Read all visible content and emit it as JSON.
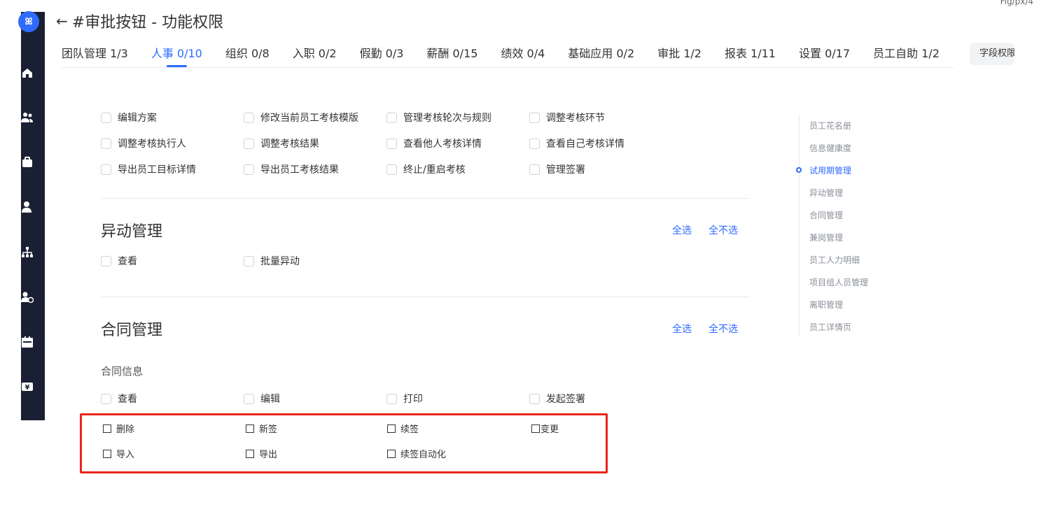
{
  "window": {
    "title": "#审批按钮 - 功能权限",
    "top_right_text": "Fig/px/4"
  },
  "sidebar": {
    "logo_text": "ꕤ",
    "icons": [
      "home-icon",
      "team-icon",
      "briefcase-icon",
      "person-icon",
      "org-chart-icon",
      "person-add-icon",
      "calendar-icon",
      "yen-icon"
    ]
  },
  "tabs": [
    {
      "label": "团队管理 1/3"
    },
    {
      "label": "人事 0/10"
    },
    {
      "label": "组织 0/8"
    },
    {
      "label": "入职 0/2"
    },
    {
      "label": "假勤 0/3"
    },
    {
      "label": "薪酬 0/15"
    },
    {
      "label": "绩效 0/4"
    },
    {
      "label": "基础应用 0/2"
    },
    {
      "label": "审批 1/2"
    },
    {
      "label": "报表 1/11"
    },
    {
      "label": "设置 0/17"
    },
    {
      "label": "员工自助 1/2"
    }
  ],
  "active_tab": 1,
  "field_perm_button": "字段权限",
  "probation": {
    "items": [
      "编辑方案",
      "修改当前员工考核模版",
      "管理考核轮次与规则",
      "调整考核环节",
      "调整考核执行人",
      "调整考核结果",
      "查看他人考核详情",
      "查看自己考核详情",
      "导出员工目标详情",
      "导出员工考核结果",
      "终止/重启考核",
      "管理签署"
    ]
  },
  "change_mgmt": {
    "title": "异动管理",
    "select_all": "全选",
    "deselect_all": "全不选",
    "items": [
      "查看",
      "批量异动"
    ]
  },
  "contract_mgmt": {
    "title": "合同管理",
    "select_all": "全选",
    "deselect_all": "全不选",
    "subsection": "合同信息",
    "items": [
      "查看",
      "编辑",
      "打印",
      "发起签署"
    ],
    "new_items": [
      "删除",
      "新签",
      "续签",
      "变更",
      "导入",
      "导出",
      "续签自动化"
    ]
  },
  "anchor_nav": {
    "items": [
      "员工花名册",
      "信息健康度",
      "试用期管理",
      "异动管理",
      "合同管理",
      "兼岗管理",
      "员工人力明细",
      "项目组人员管理",
      "离职管理",
      "员工详情页"
    ],
    "active": 2
  },
  "colors": {
    "accent": "#2f6bff",
    "sidebar": "#1b1f33",
    "highlight_frame": "#e8261a"
  }
}
